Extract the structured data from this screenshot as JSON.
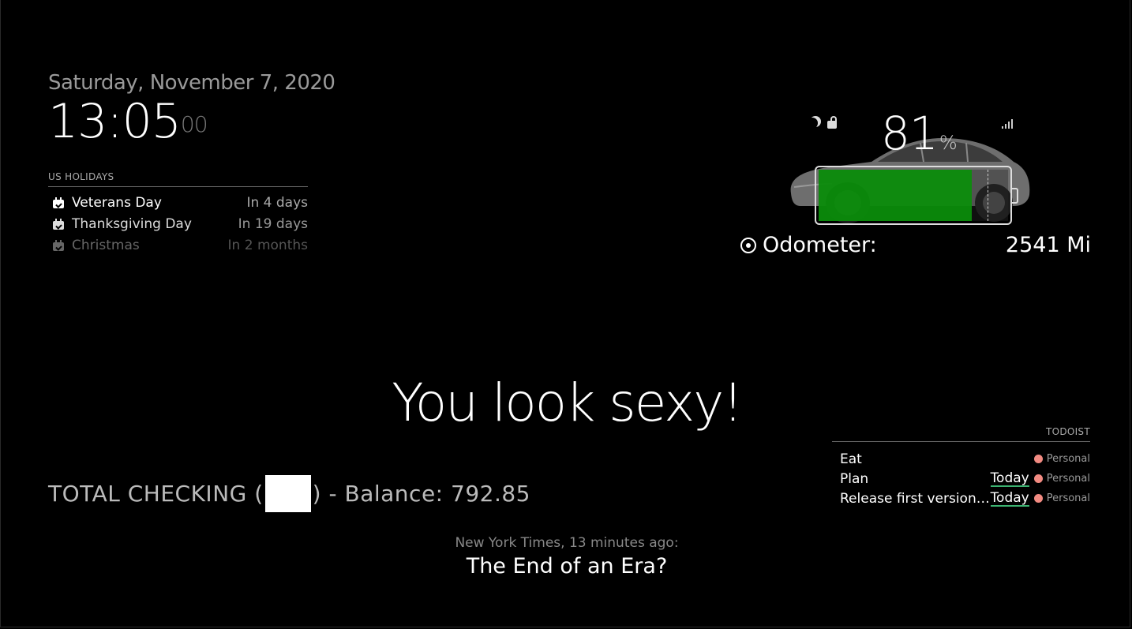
{
  "clock": {
    "date": "Saturday, November 7, 2020",
    "time": "13:05",
    "seconds": "00"
  },
  "holidays": {
    "header": "US HOLIDAYS",
    "items": [
      {
        "name": "Veterans Day",
        "when": "In 4 days",
        "icon": "calendar-check-icon"
      },
      {
        "name": "Thanksgiving Day",
        "when": "In 19 days",
        "icon": "calendar-check-icon"
      },
      {
        "name": "Christmas",
        "when": "In 2 months",
        "icon": "calendar-check-icon"
      }
    ]
  },
  "tesla": {
    "battery_percent": "81",
    "percent_unit": "%",
    "battery_level": 0.81,
    "odometer_label": "Odometer:",
    "odometer_value": "2541 Mi",
    "status_icons": [
      "moon-icon",
      "unlock-icon",
      "signal-icon"
    ],
    "battery_color": "#0a8f0a"
  },
  "compliment": {
    "text": "You look sexy!"
  },
  "bank": {
    "prefix": "TOTAL CHECKING (",
    "suffix": ") - Balance: 792.85"
  },
  "todoist": {
    "header": "TODOIST",
    "items": [
      {
        "title": "Eat",
        "due": "",
        "project": "Personal"
      },
      {
        "title": "Plan",
        "due": "Today",
        "project": "Personal"
      },
      {
        "title": "Release first version ton…",
        "due": "Today",
        "project": "Personal"
      }
    ],
    "project_color": "#f28b82",
    "due_underline_color": "#3cb371"
  },
  "news": {
    "source": "New York Times, 13 minutes ago:",
    "headline": "The End of an Era?"
  }
}
